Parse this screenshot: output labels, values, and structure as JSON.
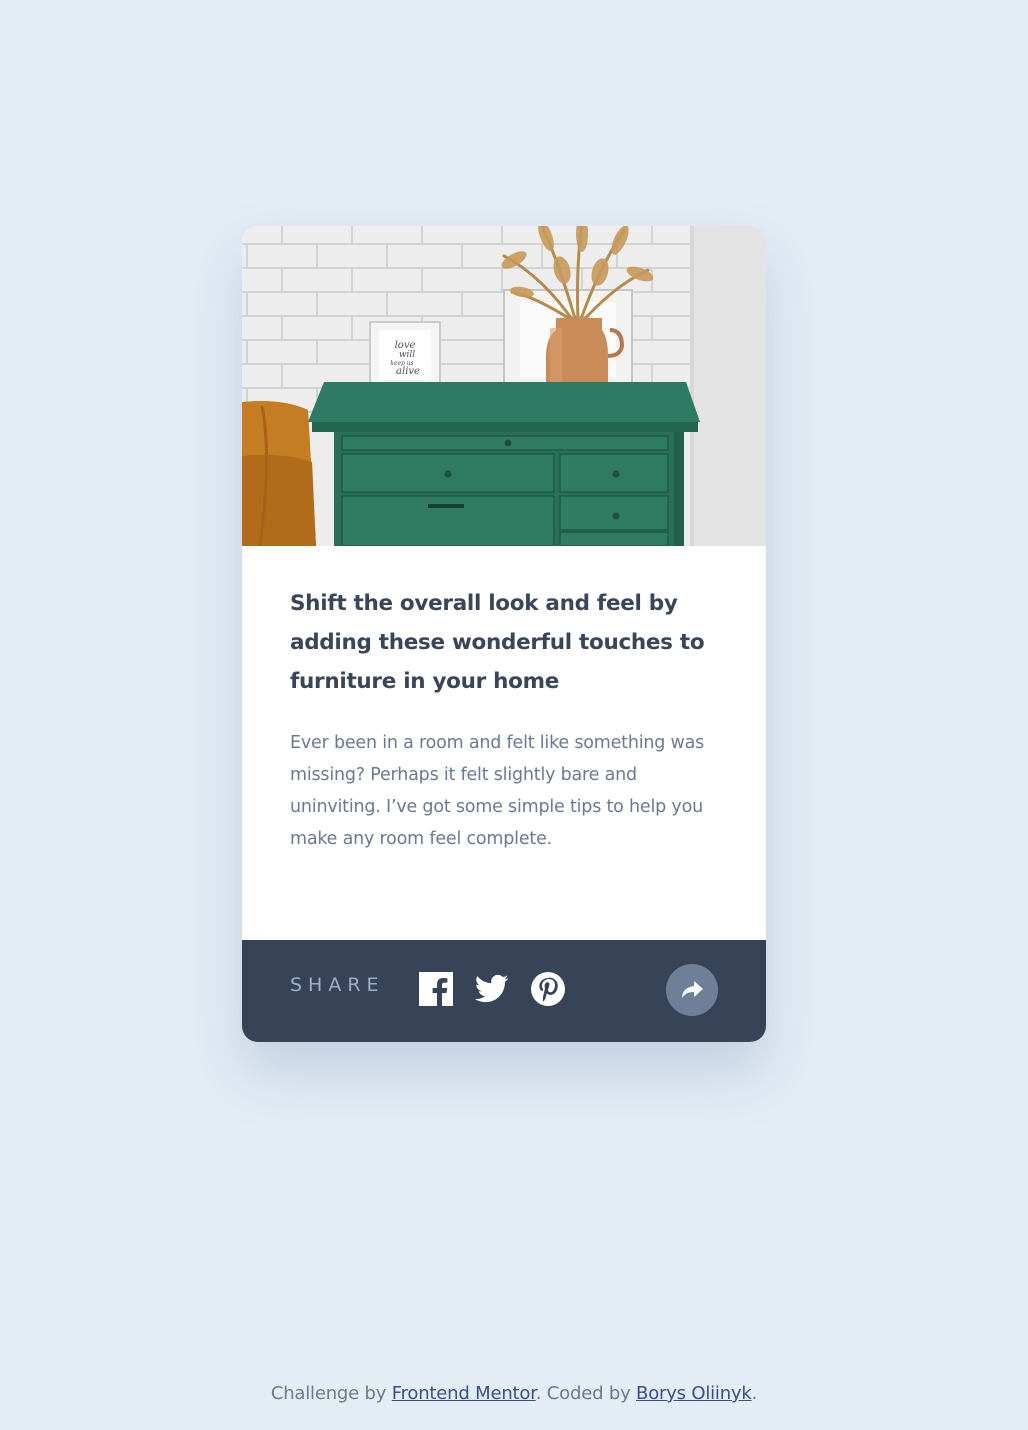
{
  "card": {
    "image_alt": "green dresser with vase of dried grass and picture frames against white brick wall",
    "frame_text": [
      "love",
      "will",
      "keep us",
      "alive"
    ],
    "title": "Shift the overall look and feel by adding these wonderful touches to furniture in your home",
    "description": "Ever been in a room and felt like something was missing? Perhaps it felt slightly bare and uninviting. I’ve got some simple tips to help you make any room feel complete."
  },
  "share": {
    "label": "SHARE",
    "icons": [
      "facebook-icon",
      "twitter-icon",
      "pinterest-icon"
    ],
    "share_button_icon": "share-arrow-icon"
  },
  "footer": {
    "prefix": "Challenge by ",
    "link1": "Frontend Mentor",
    "middle": ". Coded by ",
    "link2": "Borys Oliinyk",
    "suffix": "."
  },
  "colors": {
    "background": "#e4ecf5",
    "card": "#ffffff",
    "share_bar": "#374357",
    "title": "#3a4559",
    "body_text": "#6b7a92",
    "share_button": "#6e8098",
    "link": "#3a4d8f"
  }
}
